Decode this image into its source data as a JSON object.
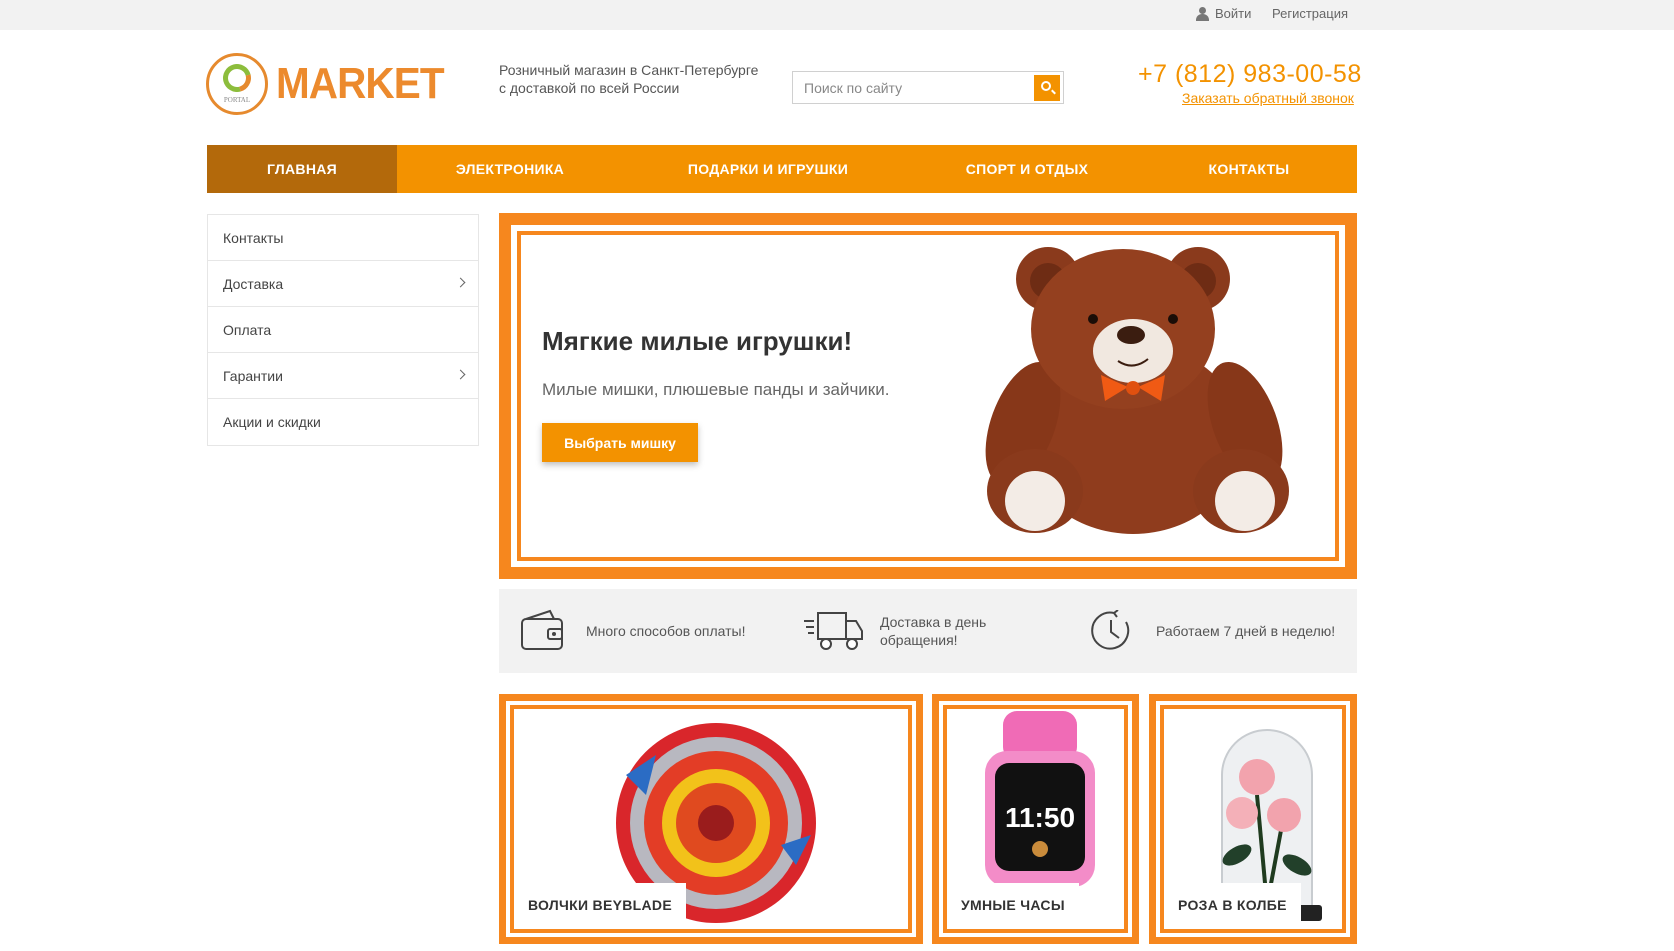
{
  "topbar": {
    "login": "Войти",
    "register": "Регистрация"
  },
  "header": {
    "logo_text": "MARKET",
    "logo_small": "PORTAL",
    "tagline_line1": "Розничный магазин в Санкт-Петербурге",
    "tagline_line2": "с доставкой по всей России",
    "search_placeholder": "Поиск по сайту",
    "phone": "+7 (812) 983-00-58",
    "callback": "Заказать обратный звонок"
  },
  "nav": {
    "items": [
      {
        "label": "ГЛАВНАЯ",
        "active": true
      },
      {
        "label": "ЭЛЕКТРОНИКА",
        "active": false
      },
      {
        "label": "ПОДАРКИ И ИГРУШКИ",
        "active": false
      },
      {
        "label": "СПОРТ И ОТДЫХ",
        "active": false
      },
      {
        "label": "КОНТАКТЫ",
        "active": false
      }
    ]
  },
  "sidebar": {
    "items": [
      {
        "label": "Контакты",
        "has_submenu": false
      },
      {
        "label": "Доставка",
        "has_submenu": true
      },
      {
        "label": "Оплата",
        "has_submenu": false
      },
      {
        "label": "Гарантии",
        "has_submenu": true
      },
      {
        "label": "Акции и скидки",
        "has_submenu": false
      }
    ]
  },
  "banner": {
    "title": "Мягкие милые игрушки!",
    "subtitle": "Милые мишки, плюшевые панды и зайчики.",
    "button": "Выбрать мишку",
    "image": "teddy-bear"
  },
  "features": {
    "items": [
      {
        "icon": "wallet-icon",
        "line1": "Много способов оплаты!",
        "line2": ""
      },
      {
        "icon": "truck-icon",
        "line1": "Доставка в день",
        "line2": "обращения!"
      },
      {
        "icon": "clock-icon",
        "line1": "Работаем 7 дней в неделю!",
        "line2": ""
      }
    ]
  },
  "products": [
    {
      "label": "ВОЛЧКИ BEYBLADE",
      "image": "beyblade-top"
    },
    {
      "label": "УМНЫЕ ЧАСЫ",
      "image": "smart-watch",
      "watch_time": "11:50"
    },
    {
      "label": "РОЗА В КОЛБЕ",
      "image": "rose-in-flask"
    }
  ],
  "colors": {
    "accent": "#f39200",
    "accent_dark": "#b3690b",
    "frame": "#f6871e"
  }
}
